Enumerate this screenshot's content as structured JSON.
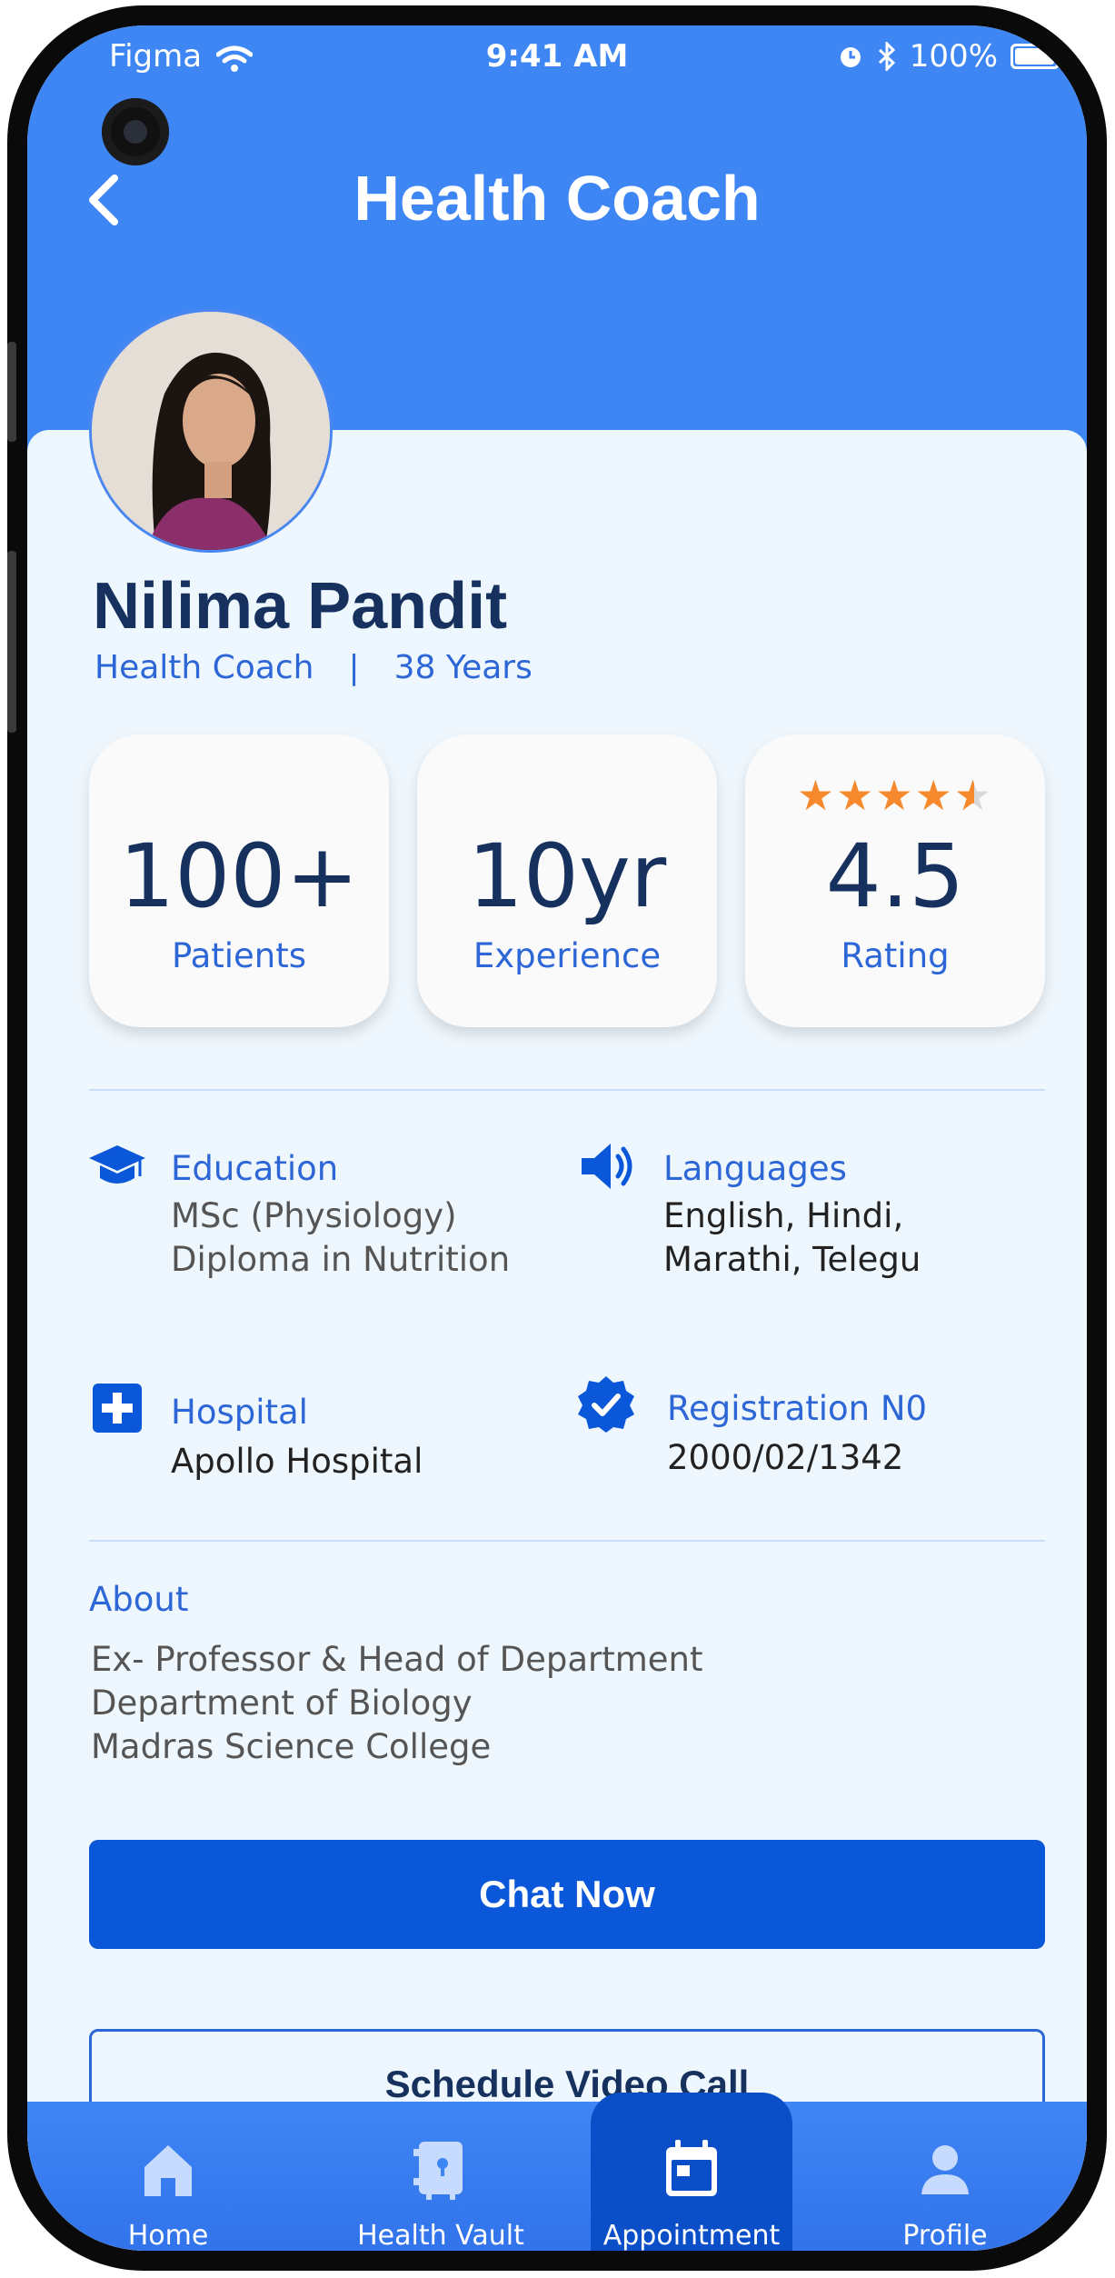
{
  "status_bar": {
    "carrier": "Figma",
    "time": "9:41 AM",
    "battery": "100%"
  },
  "header": {
    "title": "Health Coach"
  },
  "profile": {
    "name": "Nilima Pandit",
    "role": "Health Coach",
    "separator": "|",
    "age": "38 Years"
  },
  "stats": [
    {
      "value": "100+",
      "label": "Patients"
    },
    {
      "value": "10yr",
      "label": "Experience"
    },
    {
      "value": "4.5",
      "label": "Rating",
      "stars": 4.5
    }
  ],
  "info": {
    "education": {
      "title": "Education",
      "lines": [
        "MSc (Physiology)",
        "Diploma in Nutrition"
      ]
    },
    "languages": {
      "title": "Languages",
      "lines": [
        "English, Hindi,",
        "Marathi, Telegu"
      ]
    },
    "hospital": {
      "title": "Hospital",
      "lines": [
        "Apollo Hospital"
      ]
    },
    "registration": {
      "title": "Registration N0",
      "lines": [
        "2000/02/1342"
      ]
    }
  },
  "about": {
    "title": "About",
    "lines": [
      "Ex- Professor & Head of Department",
      "Department of Biology",
      "Madras Science College"
    ]
  },
  "actions": {
    "chat": "Chat Now",
    "video": "Schedule Video Call"
  },
  "tabbar": {
    "active": "Appointment",
    "items": [
      {
        "label": "Home",
        "icon": "home-icon"
      },
      {
        "label": "Health Vault",
        "icon": "vault-icon"
      },
      {
        "label": "Appointment",
        "icon": "calendar-icon"
      },
      {
        "label": "Profile",
        "icon": "profile-icon"
      }
    ]
  },
  "colors": {
    "header": "#3f86f5",
    "primary": "#0b57d9",
    "accent_text": "#2d66d6",
    "name_text": "#17315e",
    "star": "#f5892c"
  }
}
